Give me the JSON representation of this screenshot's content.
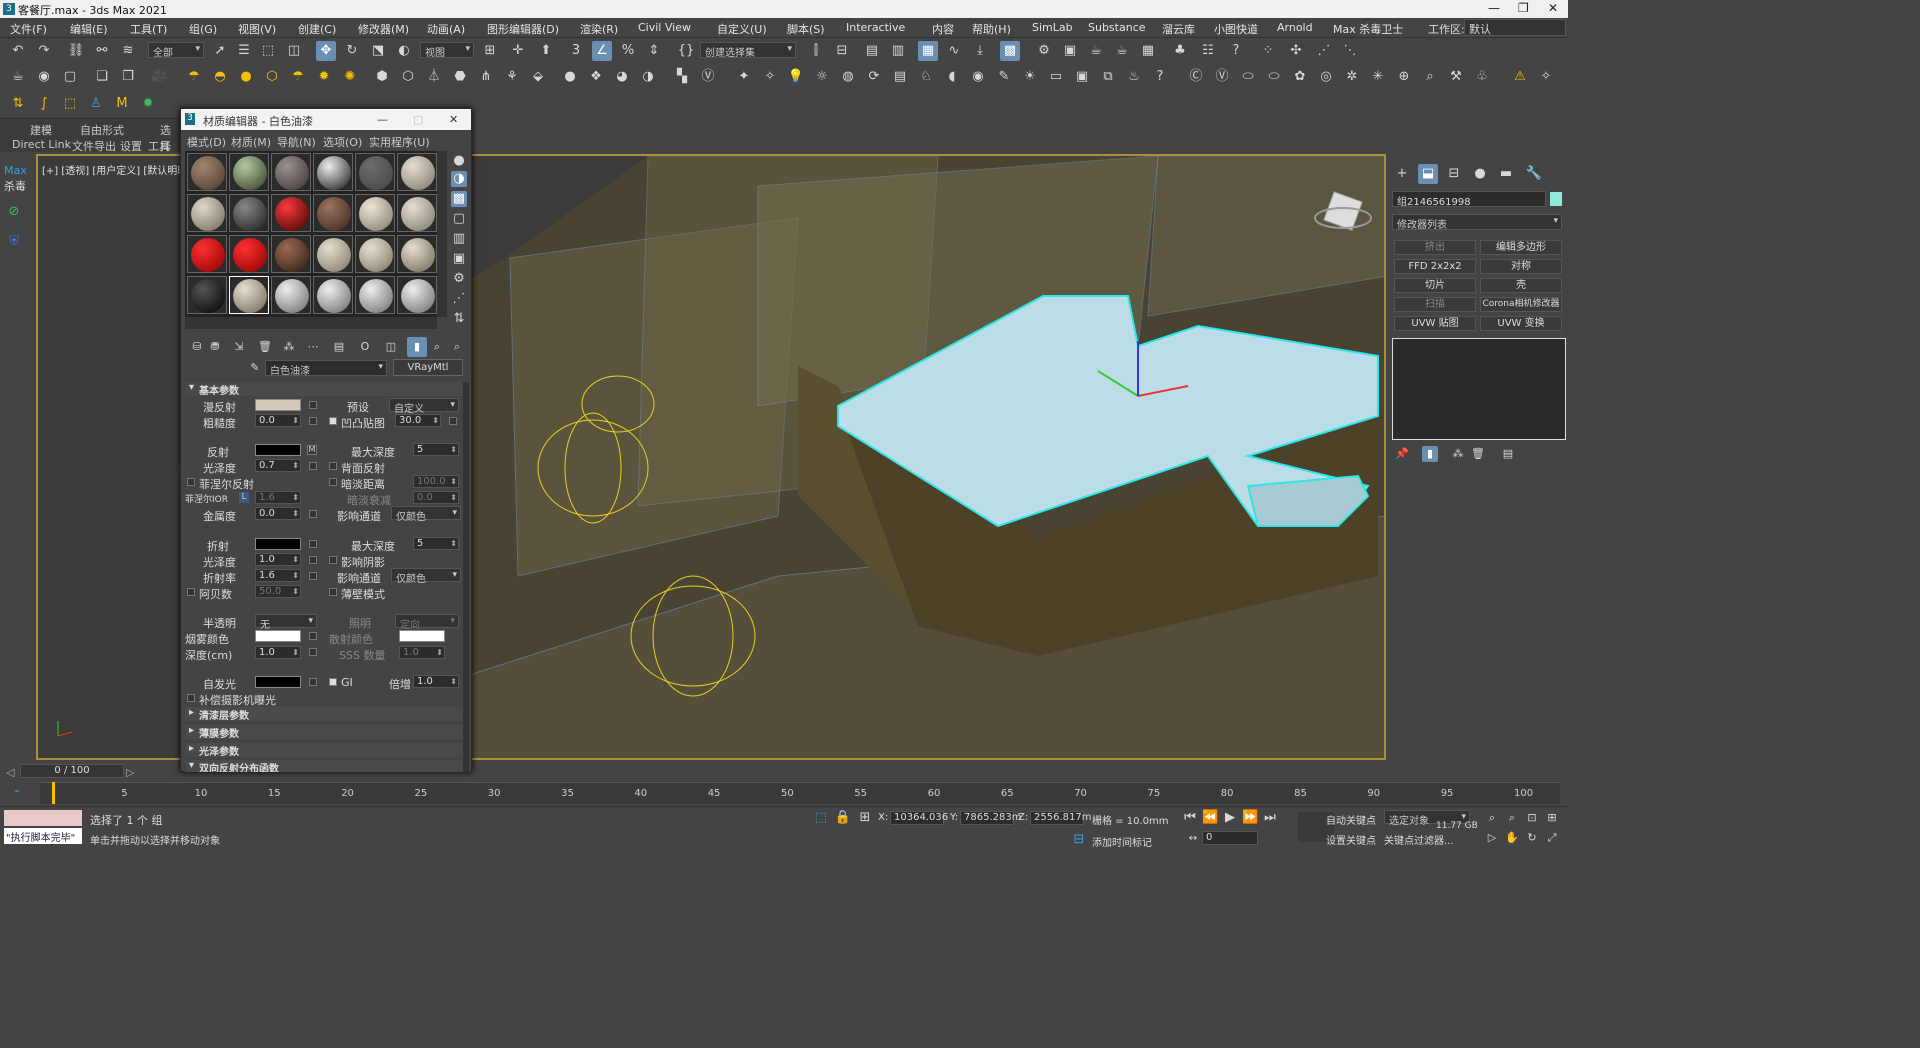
{
  "window": {
    "title": "客餐厅.max - 3ds Max 2021",
    "app_icon": "3"
  },
  "menu": [
    "文件(F)",
    "编辑(E)",
    "工具(T)",
    "组(G)",
    "视图(V)",
    "创建(C)",
    "修改器(M)",
    "动画(A)",
    "图形编辑器(D)",
    "渲染(R)",
    "Civil View",
    "自定义(U)",
    "脚本(S)",
    "Interactive",
    "内容",
    "帮助(H)",
    "SimLab",
    "Substance",
    "溜云库",
    "小图快道",
    "Arnold",
    "Max 杀毒卫士"
  ],
  "workspace": {
    "label": "工作区:",
    "value": "默认"
  },
  "toolbar": {
    "filter": "全部",
    "view_ref": "视图",
    "selset": "创建选择集"
  },
  "ribbon": {
    "tabs": [
      "建模",
      "自由形式",
      "选择"
    ],
    "tab2": [
      "Direct Link",
      "文件导出",
      "设置",
      "工具"
    ]
  },
  "leftstrip": {
    "max_label": "Max",
    "antivirus_label": "杀毒"
  },
  "viewport": {
    "label": "[+] [透视] [用户定义] [默认明暗处理]"
  },
  "material_editor": {
    "title": "材质编辑器 - 白色油漆",
    "menu": [
      "模式(D)",
      "材质(M)",
      "导航(N)",
      "选项(O)",
      "实用程序(U)"
    ],
    "material_name": "白色油漆",
    "material_type": "VRayMtl",
    "sections": {
      "basic": "基本参数",
      "coat": "清漆层参数",
      "sheen": "薄膜参数",
      "gloss": "光泽参数",
      "brdf": "双向反射分布函数"
    },
    "params": {
      "diffuse": "漫反射",
      "preset": "预设",
      "preset_val": "自定义",
      "roughness": "粗糙度",
      "roughness_val": "0.0",
      "bump": "凹凸贴图",
      "bump_val": "30.0",
      "reflect": "反射",
      "max_depth": "最大深度",
      "max_depth_val": "5",
      "gloss": "光泽度",
      "gloss_val": "0.7",
      "backface": "背面反射",
      "fresnel": "菲涅尔反射",
      "dim_dist": "暗淡距离",
      "dim_dist_val": "100.0",
      "fresnel_ior": "菲涅尔IOR",
      "fresnel_ior_val": "1.6",
      "dim_falloff": "暗淡衰减",
      "dim_falloff_val": "0.0",
      "metal": "金属度",
      "metal_val": "0.0",
      "affect_ch": "影响通道",
      "affect_ch_val": "仅颜色",
      "refract": "折射",
      "max_depth2_val": "5",
      "gloss2_val": "1.0",
      "affect_shadow": "影响阴影",
      "ior": "折射率",
      "ior_val": "1.6",
      "affect_ch2_val": "仅颜色",
      "abbe": "阿贝数",
      "abbe_val": "50.0",
      "thin": "薄壁模式",
      "translucent": "半透明",
      "translucent_val": "无",
      "illum": "照明",
      "illum_val": "定向",
      "fog": "烟雾颜色",
      "scatter": "散射颜色",
      "depth": "深度(cm)",
      "depth_val": "1.0",
      "sss": "SSS 数量",
      "sss_val": "1.0",
      "selfillum": "自发光",
      "gi": "GI",
      "mult": "倍增",
      "mult_val": "1.0",
      "compensate": "补偿摄影机曝光"
    }
  },
  "command_panel": {
    "object_name": "组2146561998",
    "modifier_list": "修改器列表",
    "buttons": [
      {
        "label": "挤出",
        "disabled": true
      },
      {
        "label": "编辑多边形",
        "disabled": false
      },
      {
        "label": "FFD 2x2x2",
        "disabled": false
      },
      {
        "label": "对称",
        "disabled": false
      },
      {
        "label": "切片",
        "disabled": false
      },
      {
        "label": "壳",
        "disabled": false
      },
      {
        "label": "扫描",
        "disabled": true
      },
      {
        "label": "Corona相机修改器",
        "disabled": false
      },
      {
        "label": "UVW 贴图",
        "disabled": false
      },
      {
        "label": "UVW 变换",
        "disabled": false
      }
    ]
  },
  "timeline": {
    "frame": "0 / 100",
    "ticks": [
      "5",
      "10",
      "15",
      "20",
      "25",
      "30",
      "35",
      "40",
      "45",
      "50",
      "55",
      "60",
      "65",
      "70",
      "75",
      "80",
      "85",
      "90",
      "95",
      "100"
    ]
  },
  "status": {
    "script_done": "\"执行脚本完毕\"",
    "selected": "选择了 1 个 组",
    "hint": "单击并拖动以选择并移动对象",
    "x": "10364.036",
    "y": "7865.283m",
    "z": "2556.817m",
    "grid": "栅格 = 10.0mm",
    "add_time_tag": "添加时间标记",
    "auto_key": "自动关键点",
    "sel_obj": "选定对象",
    "set_key": "设置关键点",
    "key_filter": "关键点过滤器...",
    "frame_field": "0",
    "mem": "11.77 GB"
  }
}
